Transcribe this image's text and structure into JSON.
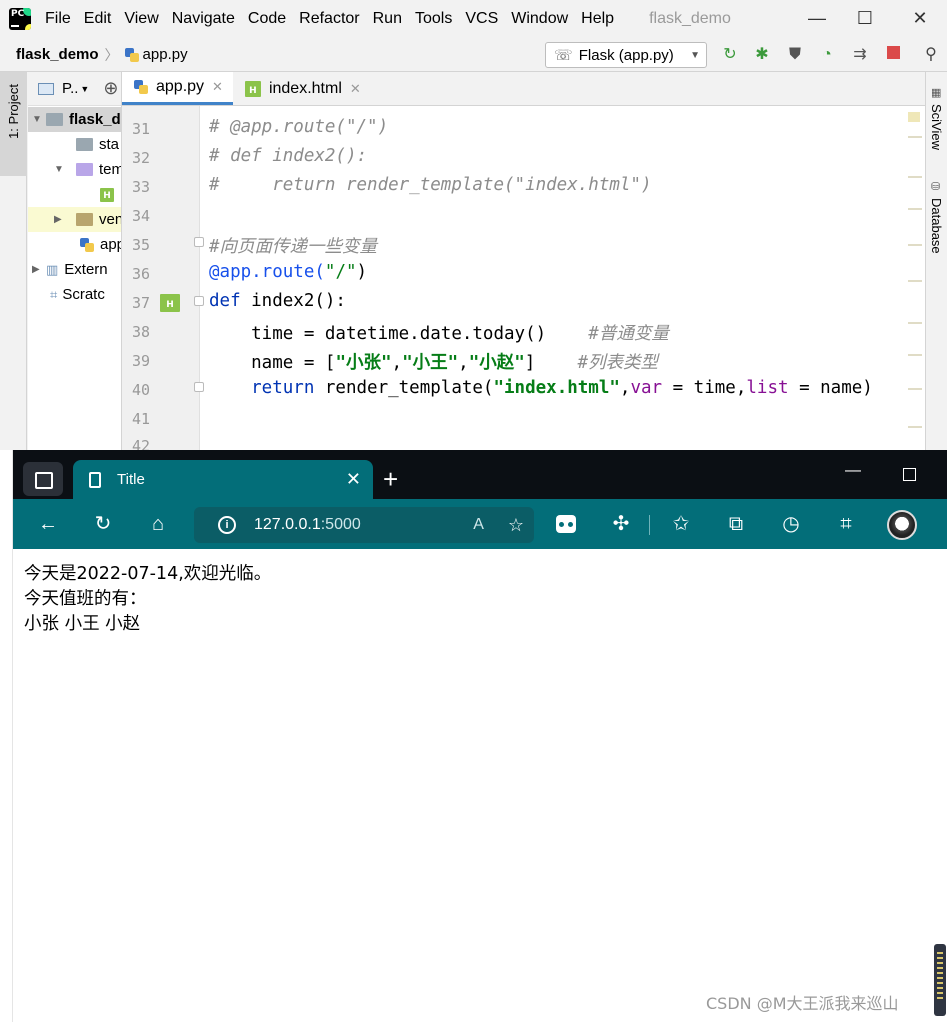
{
  "ide": {
    "menu": [
      "File",
      "Edit",
      "View",
      "Navigate",
      "Code",
      "Refactor",
      "Run",
      "Tools",
      "VCS",
      "Window",
      "Help"
    ],
    "window_title": "flask_demo",
    "breadcrumb": {
      "project": "flask_demo",
      "file": "app.py"
    },
    "run_config": "Flask (app.py)",
    "left_tool_tab": "1: Project",
    "right_tool_tabs": [
      "SciView",
      "Database"
    ],
    "project_panel": {
      "header": "P..",
      "items": [
        {
          "label": "flask_d"
        },
        {
          "label": "sta"
        },
        {
          "label": "tem"
        },
        {
          "label": "ven"
        },
        {
          "label": "app"
        },
        {
          "label": "Extern"
        },
        {
          "label": "Scratc"
        }
      ]
    },
    "tabs": [
      {
        "label": "app.py"
      },
      {
        "label": "index.html"
      }
    ],
    "line_numbers": [
      "31",
      "32",
      "33",
      "34",
      "35",
      "36",
      "37",
      "38",
      "39",
      "40",
      "41",
      "42"
    ],
    "code": {
      "l31": "# @app.route(\"/\")",
      "l32": "# def index2():",
      "l33": "#     return render_template(\"index.html\")",
      "l35": "#向页面传递一些变量",
      "l36_deco": "@app.route(",
      "l36_str": "\"/\"",
      "l36_close": ")",
      "l37_kw": "def",
      "l37_rest": " index2():",
      "l38_code": "    time = datetime.date.today()    ",
      "l38_comment": "#普通变量",
      "l39_a": "    name = [",
      "l39_s1": "\"小张\"",
      "l39_c1": ",",
      "l39_s2": "\"小王\"",
      "l39_c2": ",",
      "l39_s3": "\"小赵\"",
      "l39_b": "]    ",
      "l39_comment": "#列表类型",
      "l40_kw": "    return",
      "l40_a": " render_template(",
      "l40_s": "\"index.html\"",
      "l40_b": ",",
      "l40_p1": "var",
      "l40_c": " = time,",
      "l40_p2": "list",
      "l40_d": " = name)"
    }
  },
  "browser": {
    "tab_title": "Title",
    "address_host": "127.0.0.1",
    "address_port": ":5000",
    "content": {
      "line1": "今天是2022-07-14,欢迎光临。",
      "line2": "今天值班的有：",
      "line3": "小张 小王 小赵"
    },
    "accent_color": "#036e79"
  },
  "watermark": "CSDN @M大王派我来巡山"
}
